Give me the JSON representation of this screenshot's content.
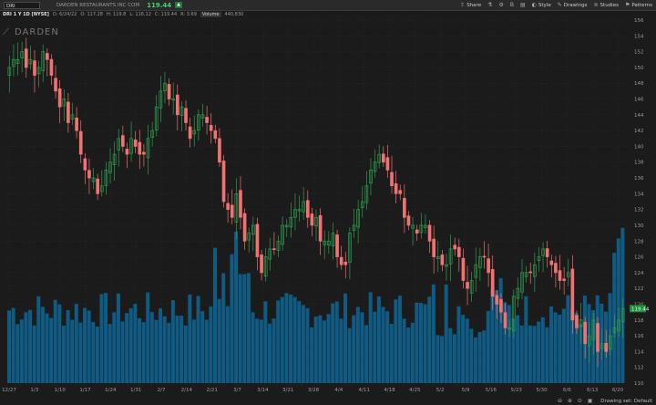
{
  "toolbar": {
    "symbol": "DRI",
    "company": "DARDEN RESTAURANTS INC COM",
    "last_price": "119.44",
    "change_badge": "▲",
    "buttons": [
      {
        "label": "Share",
        "icon": "share-icon"
      },
      {
        "label": "",
        "icon": "flask-icon"
      },
      {
        "label": "",
        "icon": "gear-icon"
      },
      {
        "label": "",
        "icon": "bold-icon"
      },
      {
        "label": "",
        "icon": "save-icon"
      },
      {
        "label": "Style",
        "icon": "style-icon"
      },
      {
        "label": "Drawings",
        "icon": "pencil-icon"
      },
      {
        "label": "Studies",
        "icon": "studies-icon"
      },
      {
        "label": "Patterns",
        "icon": "patterns-icon"
      }
    ]
  },
  "info": {
    "symbol": "DRI 1 Y 1D [NYSE]",
    "date": "D: 6/24/22",
    "open": "O: 117.28",
    "high": "H: 119.8",
    "low": "L: 116.12",
    "close": "C: 119.44",
    "range": "R: 3.69",
    "volume_label": "Volume",
    "volume": "440,830"
  },
  "logo": "DARDEN",
  "status": {
    "drawing_set": "Drawing set: Default"
  },
  "colors": {
    "up": "#2e9e4f",
    "down": "#f07272",
    "volume": "#0f5f8a",
    "background": "#1b1b1b",
    "grid": "#2e2e2e",
    "price_tag": "#1f8f3c"
  },
  "chart_data": {
    "type": "candlestick",
    "ylim": [
      110,
      156
    ],
    "yticks": [
      110,
      112,
      114,
      116,
      118,
      120,
      122,
      124,
      126,
      128,
      130,
      132,
      134,
      136,
      138,
      140,
      142,
      144,
      146,
      148,
      150,
      152,
      154,
      156
    ],
    "xticks": [
      "12/27",
      "1/3",
      "1/10",
      "1/17",
      "1/24",
      "1/31",
      "2/7",
      "2/14",
      "2/21",
      "3/7",
      "3/14",
      "3/21",
      "3/28",
      "4/4",
      "4/11",
      "4/18",
      "4/25",
      "5/2",
      "5/9",
      "5/16",
      "5/23",
      "5/30",
      "6/6",
      "6/13",
      "6/20"
    ],
    "last_price_label": "119.44",
    "close_series": [
      150,
      151,
      151,
      152,
      150,
      151,
      149,
      150,
      152,
      151,
      149,
      147,
      145,
      146,
      143,
      144,
      142,
      139,
      137,
      136,
      136,
      134,
      135,
      137,
      138,
      139,
      141,
      140,
      139,
      141,
      140,
      139,
      139,
      141,
      142,
      145,
      147,
      148,
      146,
      146,
      144,
      145,
      143,
      141,
      142,
      144,
      144,
      143,
      142,
      141,
      138,
      133,
      132,
      131,
      134,
      131,
      128,
      129,
      130,
      126,
      124,
      126,
      127,
      127,
      128,
      130,
      130,
      131,
      132,
      132,
      133,
      131,
      130,
      131,
      128,
      128,
      128,
      129,
      126,
      125,
      125,
      129,
      130,
      132,
      133,
      135,
      137,
      138,
      139,
      138,
      137,
      135,
      134,
      134,
      131,
      130,
      130,
      129,
      130,
      130,
      128,
      126,
      126,
      125,
      125,
      127,
      127,
      126,
      123,
      122,
      123,
      125,
      126,
      126,
      124,
      121,
      120,
      119,
      117,
      117,
      121,
      122,
      124,
      124,
      124,
      125,
      126,
      127,
      126,
      125,
      124,
      123,
      123,
      124,
      118,
      117,
      118,
      115,
      116,
      118,
      114,
      115,
      114,
      116,
      117,
      118,
      119.44
    ],
    "volume_note": "volume histogram shown at bottom; values relative only"
  }
}
